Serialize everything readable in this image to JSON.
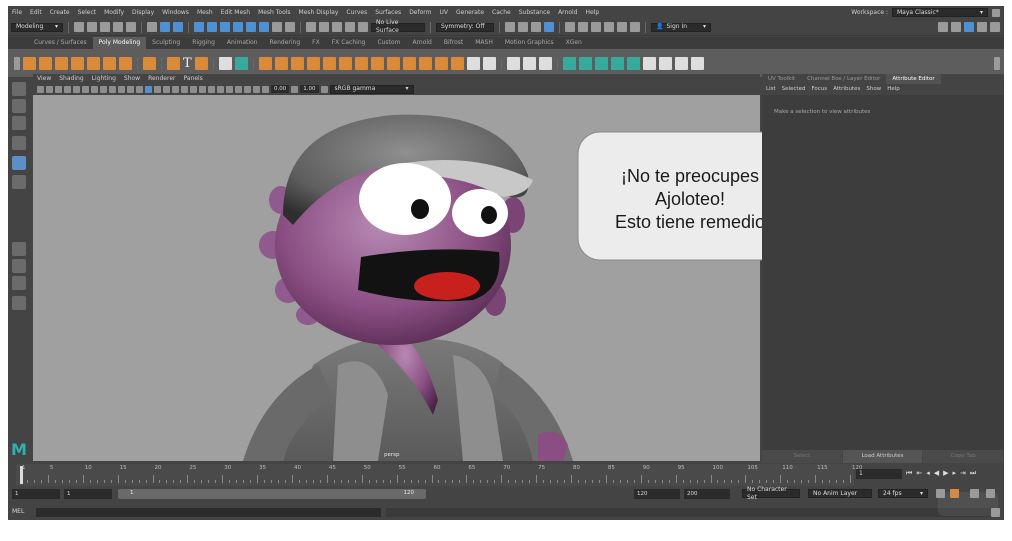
{
  "menubar": {
    "items": [
      "File",
      "Edit",
      "Create",
      "Select",
      "Modify",
      "Display",
      "Windows",
      "Mesh",
      "Edit Mesh",
      "Mesh Tools",
      "Mesh Display",
      "Curves",
      "Surfaces",
      "Deform",
      "UV",
      "Generate",
      "Cache",
      "Substance",
      "Arnold",
      "Help"
    ],
    "workspace_label": "Workspace :",
    "workspace_value": "Maya Classic*"
  },
  "statusline": {
    "mode": "Modeling",
    "live_surface": "No Live Surface",
    "symmetry": "Symmetry: Off",
    "sign_in": "Sign In"
  },
  "shelf_tabs": {
    "items": [
      "Curves / Surfaces",
      "Poly Modeling",
      "Sculpting",
      "Rigging",
      "Animation",
      "Rendering",
      "FX",
      "FX Caching",
      "Custom",
      "Arnold",
      "Bifrost",
      "MASH",
      "Motion Graphics",
      "XGen"
    ],
    "active": "Poly Modeling"
  },
  "viewport": {
    "menu": [
      "View",
      "Shading",
      "Lighting",
      "Show",
      "Renderer",
      "Panels"
    ],
    "exposure": "0.00",
    "gamma": "1.00",
    "color_space": "sRGB gamma",
    "camera_label": "persp"
  },
  "right_panel": {
    "tabs": [
      "UV Toolkit",
      "Channel Box / Layer Editor",
      "Attribute Editor"
    ],
    "active_tab": "Attribute Editor",
    "menu": [
      "List",
      "Selected",
      "Focus",
      "Attributes",
      "Show",
      "Help"
    ],
    "hint": "Make a selection to view attributes",
    "buttons": [
      "Select",
      "Load Attributes",
      "Copy Tab"
    ]
  },
  "timeline": {
    "ticks": [
      "1",
      "5",
      "10",
      "15",
      "20",
      "25",
      "30",
      "35",
      "40",
      "45",
      "50",
      "55",
      "60",
      "65",
      "70",
      "75",
      "80",
      "85",
      "90",
      "95",
      "100",
      "105",
      "110",
      "115",
      "120"
    ],
    "current_frame": "1"
  },
  "range": {
    "start": "1",
    "start2": "1",
    "range_start_label": "1",
    "range_end_label": "120",
    "end": "120",
    "end2": "200",
    "character_set": "No Character Set",
    "anim_layer": "No Anim Layer",
    "fps": "24 fps"
  },
  "command": {
    "mel": "MEL"
  },
  "speech_bubble": {
    "lines": [
      "¡No te preocupes",
      "Ajoloteo!",
      "Esto tiene remedio"
    ]
  },
  "colors": {
    "maya_bg": "#444444",
    "viewport_bg": "#a0a0a0",
    "accent_blue": "#5a8fc8",
    "character_purple": "#8a4e82",
    "mouth_red": "#c8201c"
  }
}
